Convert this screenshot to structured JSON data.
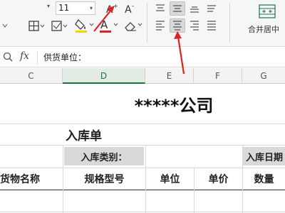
{
  "ribbon": {
    "font_size": "11",
    "icons": [
      "borders-icon",
      "fill-color-icon",
      "font-color-icon",
      "eraser-icon",
      "increase-font-icon",
      "decrease-font-icon",
      "align-top-icon",
      "align-middle-icon",
      "align-bottom-icon",
      "align-left-icon",
      "align-center-icon",
      "align-right-icon",
      "distributed-icon",
      "merge-center-icon"
    ],
    "merge_label": "合并居中"
  },
  "formula_bar": {
    "fx": "fx",
    "content": "供货单位："
  },
  "columns": [
    "C",
    "D",
    "E",
    "F",
    "G"
  ],
  "selected_column": "D",
  "sheet": {
    "company": "*****公司",
    "title": "入库单",
    "category_label": "入库类别：",
    "date_label": "入库日期",
    "headers": {
      "name": "货物名称",
      "spec": "规格型号",
      "unit": "单位",
      "price": "单价",
      "qty": "数量"
    }
  },
  "colors": {
    "accent_green": "#217346",
    "arrow_red": "#e02020",
    "label_fill": "#d9d9d9"
  }
}
